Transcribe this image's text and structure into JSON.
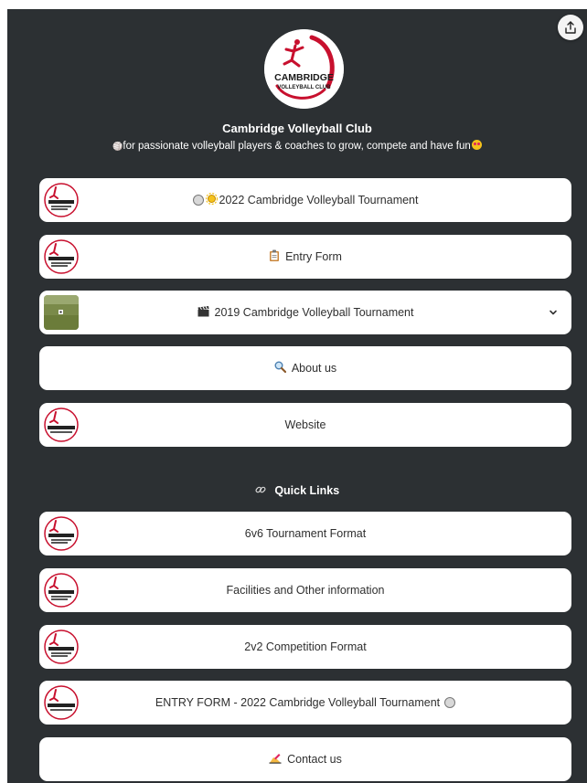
{
  "profile": {
    "name": "Cambridge Volleyball Club",
    "bio_prefix": "🏐",
    "bio": "for passionate volleyball players & coaches to grow, compete and have fun",
    "logo_text_line1": "CAMBRIDGE",
    "logo_text_line2": "VOLLEYBALL CLUB"
  },
  "share": {
    "icon": "share-icon"
  },
  "links": [
    {
      "label": "2022 Cambridge Volleyball Tournament",
      "icon": "volleyball-sun-icons",
      "thumb": "tournament-logo"
    },
    {
      "label": "Entry Form",
      "icon": "clipboard-icon",
      "thumb": "tournament-logo"
    },
    {
      "label": "2019 Cambridge Volleyball Tournament",
      "icon": "clapper-board-icon",
      "thumb": "field-photo"
    },
    {
      "label": "About us",
      "icon": "magnifying-glass-icon",
      "thumb": ""
    },
    {
      "label": "Website",
      "icon": "",
      "thumb": "club-logo"
    }
  ],
  "quick_links": {
    "heading": "Quick Links",
    "icon": "link-icon",
    "items": [
      {
        "label": "6v6 Tournament Format",
        "thumb": "tournament-logo"
      },
      {
        "label": "Facilities and Other information",
        "thumb": "tournament-logo"
      },
      {
        "label": "2v2 Competition Format",
        "thumb": "tournament-logo"
      },
      {
        "label": "ENTRY FORM - 2022 Cambridge Volleyball Tournament",
        "thumb": "club-logo"
      },
      {
        "label": "Contact us",
        "icon": "writing-hand-icon",
        "thumb": ""
      }
    ]
  },
  "colors": {
    "background": "#2c3033",
    "card": "#ffffff",
    "text": "#2f2f2f",
    "logo_red": "#c8102e"
  }
}
